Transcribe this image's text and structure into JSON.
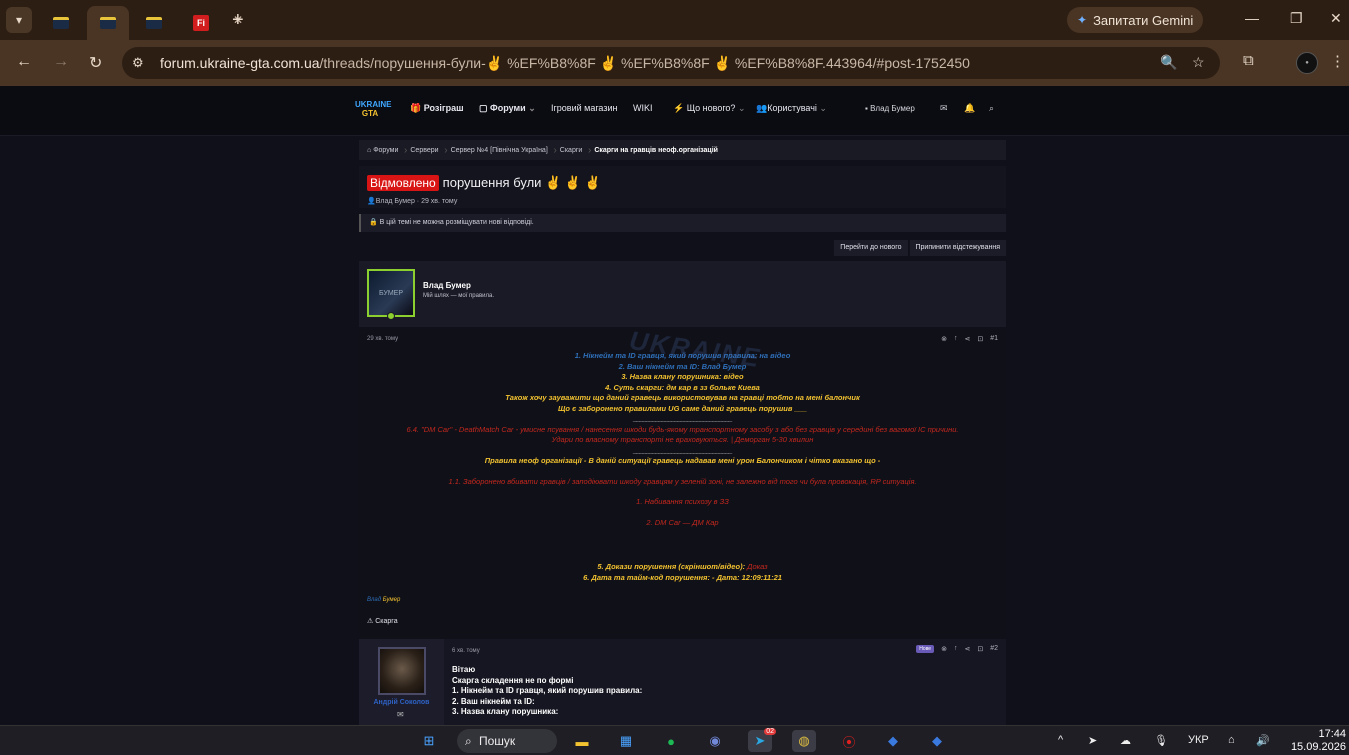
{
  "browser": {
    "tabs": [
      {
        "favicon": "ukraine-gta-favicon"
      },
      {
        "favicon": "ukraine-gta-favicon"
      },
      {
        "favicon": "ukraine-gta-favicon"
      },
      {
        "favicon": "fi-favicon",
        "favicon_text": "Fi"
      }
    ],
    "gemini_label": "Запитати Gemini",
    "url_host": "forum.ukraine-gta.com.ua",
    "url_path": "/threads/порушення-були-✌️ %EF%B8%8F ✌️ %EF%B8%8F ✌️ %EF%B8%8F.443964/#post-1752450"
  },
  "site": {
    "logo_top": "UKRAINE",
    "logo_bottom": "GTA",
    "nav": {
      "giveaway": "Розіграш",
      "forums": "Форуми",
      "shop": "Ігровий магазин",
      "wiki": "WIKI",
      "whats_new": "Що нового?",
      "users": "Користувачі"
    },
    "header_user": "Влад Бумер"
  },
  "breadcrumbs": [
    "Форуми",
    "Сервери",
    "Сервер №4 [Північна Україна]",
    "Скарги",
    "Скарги на гравців неоф.організацій"
  ],
  "thread": {
    "status": "Відмовлено",
    "title": "порушення були ✌️ ✌️ ✌️",
    "meta": "Влад Бумер · 29 хв. тому",
    "closed_notice": "В цій темі не можна розміщувати нові відповіді.",
    "actions": {
      "goto_new": "Перейти до нового",
      "unwatch": "Припинити відстежування"
    }
  },
  "post1": {
    "author": "Влад Бумер",
    "author_title": "Мій шлях — мої правила.",
    "avatar_text": "БУМЕР",
    "time": "29 хв. тому",
    "number": "#1",
    "watermark": "UKRAINE",
    "lines": {
      "l1": "1. Нікнейм та ID гравця, який порушив правила: на відео",
      "l2": "2. Ваш нікнейм та ID: Влад Бумер",
      "l3": "3. Назва клану порушника: відео",
      "l4": "4. Суть скарги: дм кар в зз больке Киева",
      "l5": "Також хочу зауважити що даний гравець використовував на гравці тобто на мені балончик",
      "l6": "Що є заборонено правилами UG саме даний гравець порушив ___",
      "sep1": "_______________________________",
      "r1": "6.4. \"DM Car\" - DeathMatch Car - умисне псування / нанесення шкоди будь-якому транспортному засобу з або без гравців у середині без вагомої IC причини.",
      "r2": "Удари по власному транспорті не враховуються. | Деморган 5-30 хвилин",
      "sep2": "_______________________________",
      "l7": "Правила неоф організації - В даній ситуації гравець надавав мені урон Балончиком і чітко вказано що -",
      "r3": "1.1. Заборонено вбивати гравців / заподіювати шкоду гравцям у зеленій зоні, не залежно від того чи була провокація, RP ситуація.",
      "r4": "1. Набивання психозу в ЗЗ",
      "r5": "2. DM Car — ДМ Кар",
      "l8a": "5. Докази порушення (скріншот/відео): ",
      "l8b": "Доказ",
      "l9": "6. Дата та тайм-код порушення: - Дата: 12:09:11:21"
    },
    "signature_a": "Влад",
    "signature_b": "Бумер",
    "complaint": "Скарга"
  },
  "post2": {
    "author": "Андрій Соколов",
    "time": "6 хв. тому",
    "badge": "Нове",
    "number": "#2",
    "lines": [
      "Вітаю",
      "Скарга складення не по формі",
      "1. Нікнейм та ID гравця, який порушив правила:",
      "2. Ваш нікнейм та ID:",
      "3. Назва клану порушника:"
    ]
  },
  "taskbar": {
    "search": "Пошук",
    "telegram_badge": "02",
    "lang": "УКР",
    "time": "17:44",
    "date": "15.09.2026"
  },
  "colors": {
    "accent_blue": "#2e6fb8",
    "accent_yellow": "#f2c230",
    "accent_red": "#c4281e",
    "status_red": "#d91414"
  }
}
